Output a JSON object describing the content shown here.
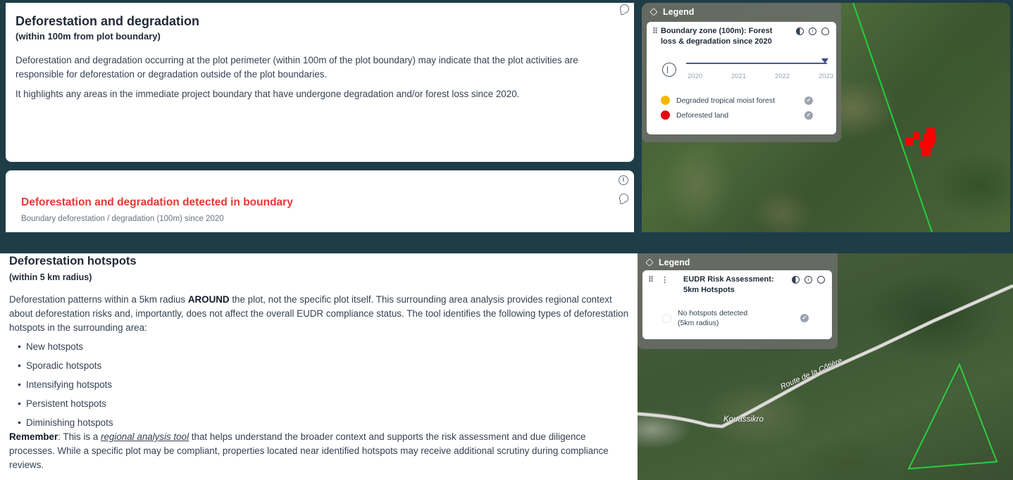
{
  "section1": {
    "title": "Deforestation and degradation",
    "subtitle": "(within 100m from plot boundary)",
    "para1": "Deforestation and degradation occurring at the plot perimeter (within 100m of the plot boundary) may indicate that the plot activities are responsible for deforestation or degradation outside of the plot boundaries.",
    "para2": "It highlights any areas in the immediate project boundary that have undergone degradation and/or forest loss since 2020."
  },
  "section2": {
    "title": "Deforestation and degradation detected in boundary",
    "subtitle": "Boundary deforestation / degradation (100m) since 2020",
    "title_color": "#e53935"
  },
  "legend1": {
    "header": "Legend",
    "layer_title": "Boundary zone (100m): Forest loss & degradation since 2020",
    "years": [
      "2020",
      "2021",
      "2022",
      "2023"
    ],
    "items": [
      {
        "label": "Degraded tropical moist forest",
        "color": "#f5b800"
      },
      {
        "label": "Deforested land",
        "color": "#e50914"
      }
    ]
  },
  "section3": {
    "title": "Deforestation hotspots",
    "subtitle": "(within 5 km radius)",
    "para1_a": "Deforestation patterns within a 5km radius ",
    "para1_bold": "AROUND",
    "para1_b": " the plot, not the specific plot itself. This surrounding area analysis provides regional context about deforestation risks and, importantly, does not affect the overall EUDR compliance status. The tool identifies the following types of deforestation hotspots in the surrounding area:",
    "bullets": [
      "New hotspots",
      "Sporadic hotspots",
      "Intensifying hotspots",
      "Persistent hotspots",
      "Diminishing hotspots"
    ],
    "remember_bold": "Remember",
    "remember_a": ": This is a ",
    "remember_link": "regional analysis tool",
    "remember_b": " that helps understand the broader context and supports the risk assessment and due diligence processes. While a specific plot may be compliant, properties located near identified hotspots may receive additional scrutiny during compliance reviews."
  },
  "legend2": {
    "header": "Legend",
    "layer_title": "EUDR Risk Assessment: 5km Hotspots",
    "item": "No hotspots detected (5km radius)"
  },
  "map2": {
    "road_label": "Route de la Côtière",
    "town_label": "Kouassikro"
  },
  "colors": {
    "plot_boundary": "#22c55e",
    "deforested": "#ff0000",
    "background": "#1f3d47"
  }
}
